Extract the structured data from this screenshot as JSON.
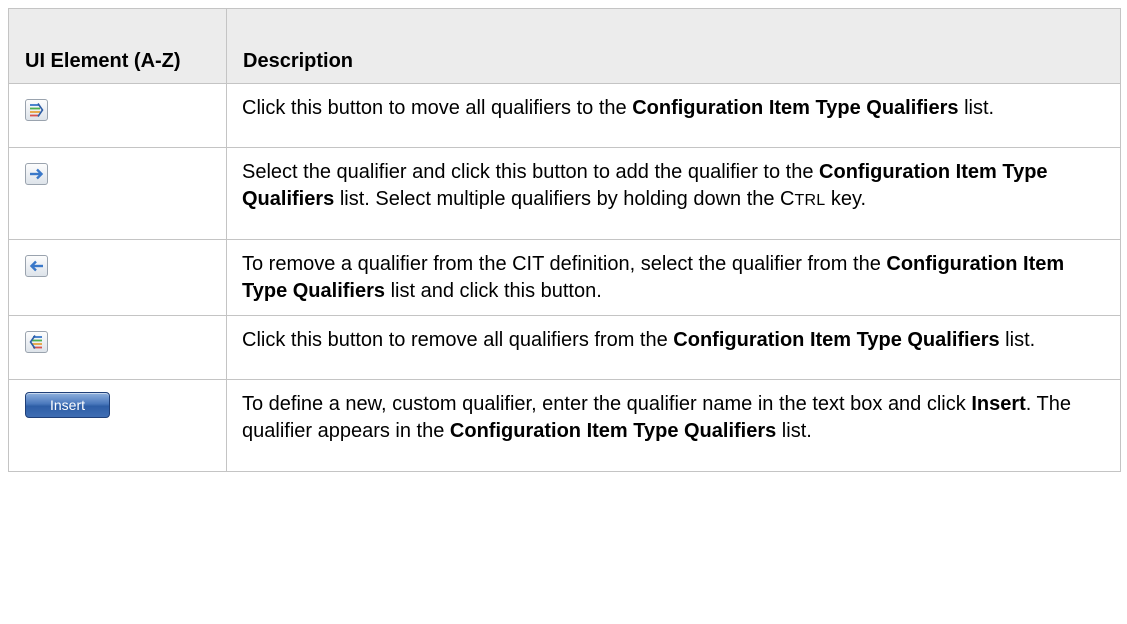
{
  "table": {
    "headers": {
      "element": "UI Element (A-Z)",
      "description": "Description"
    },
    "rows": [
      {
        "icon": "move-all-right-icon",
        "segments": [
          {
            "t": "Click this button to move all qualifiers to the ",
            "s": "n"
          },
          {
            "t": "Configuration Item Type Qualifiers",
            "s": "b"
          },
          {
            "t": " list.",
            "s": "n"
          }
        ]
      },
      {
        "icon": "move-right-icon",
        "segments": [
          {
            "t": "Select the qualifier and click this button to add the qualifier to the ",
            "s": "n"
          },
          {
            "t": "Configuration Item Type Qualifiers",
            "s": "b"
          },
          {
            "t": " list. Select multiple qualifiers by holding down the C",
            "s": "n"
          },
          {
            "t": "TRL",
            "s": "sc"
          },
          {
            "t": " key.",
            "s": "n"
          }
        ]
      },
      {
        "icon": "move-left-icon",
        "segments": [
          {
            "t": "To remove a qualifier from the CIT definition, select the qualifier from the ",
            "s": "n"
          },
          {
            "t": "Configuration Item Type Qualifiers",
            "s": "b"
          },
          {
            "t": " list and click this button.",
            "s": "n"
          }
        ]
      },
      {
        "icon": "move-all-left-icon",
        "segments": [
          {
            "t": "Click this button to remove all qualifiers from the ",
            "s": "n"
          },
          {
            "t": "Configuration Item Type Qualifiers",
            "s": "b"
          },
          {
            "t": " list.",
            "s": "n"
          }
        ]
      },
      {
        "icon": "insert-button",
        "button_label": "Insert",
        "segments": [
          {
            "t": "To define a new, custom qualifier, enter the qualifier name in the text box and click ",
            "s": "n"
          },
          {
            "t": "Insert",
            "s": "b"
          },
          {
            "t": ". The qualifier appears in the ",
            "s": "n"
          },
          {
            "t": "Configuration Item Type Qualifiers",
            "s": "b"
          },
          {
            "t": " list.",
            "s": "n"
          }
        ]
      }
    ]
  },
  "colors": {
    "header_bg": "#ececec",
    "border": "#c4c4c4",
    "insert_button": "#3f6db3",
    "arrow_blue": "#3a78c9"
  }
}
